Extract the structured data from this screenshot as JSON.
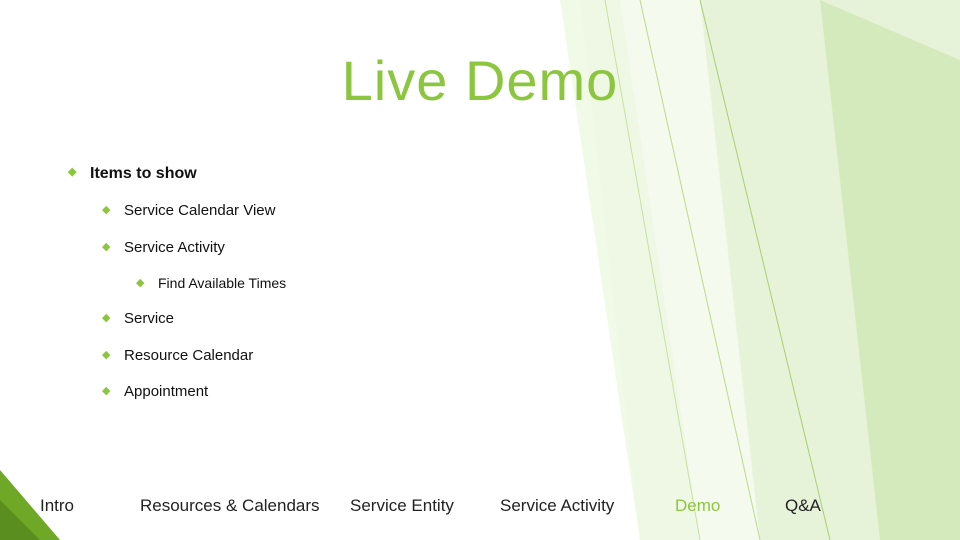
{
  "title": "Live Demo",
  "bullets": {
    "heading": "Items to show",
    "items": [
      "Service Calendar View",
      "Service Activity",
      "Service",
      "Resource Calendar",
      "Appointment"
    ],
    "sub_of_1": "Find Available Times"
  },
  "nav": {
    "intro": "Intro",
    "resources": "Resources & Calendars",
    "entity": "Service Entity",
    "activity": "Service Activity",
    "demo": "Demo",
    "qa": "Q&A"
  }
}
